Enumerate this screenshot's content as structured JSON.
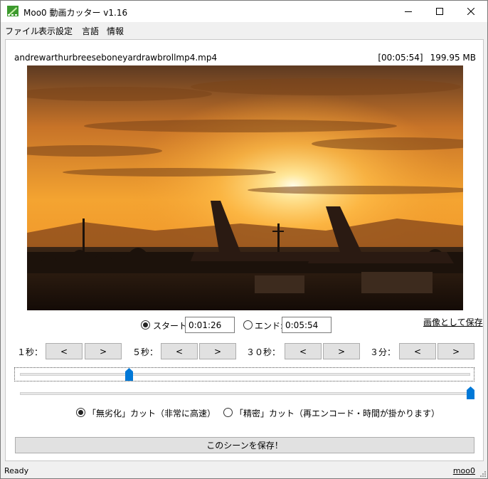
{
  "window": {
    "title": "Moo0 動画カッター v1.16"
  },
  "menu": [
    "ファイル",
    "表示設定",
    "言語",
    "情報"
  ],
  "file": {
    "name": "andrewarthurbreeseboneyardrawbrollmp4.mp4",
    "duration": "[00:05:54]",
    "size": "199.95 MB"
  },
  "video": {
    "description_icon": "video-frame",
    "accent": "#f5a623"
  },
  "range": {
    "start_label": "スタート:",
    "start_value": "0:01:26",
    "end_label": "エンド:",
    "end_value": "0:05:54",
    "save_image_link": "画像として保存",
    "selected": "start"
  },
  "steps": [
    {
      "label": "１秒：",
      "back": "<",
      "forward": ">"
    },
    {
      "label": "５秒：",
      "back": "<",
      "forward": ">"
    },
    {
      "label": "３０秒：",
      "back": "<",
      "forward": ">"
    },
    {
      "label": "３分：",
      "back": "<",
      "forward": ">"
    }
  ],
  "sliders": {
    "start_fraction": 0.243,
    "end_fraction": 1.0,
    "thumb_color": "#0078d7"
  },
  "modes": {
    "lossless": "「無劣化」カット（非常に高速）",
    "precise": "「精密」カット（再エンコード・時間が掛かります）",
    "selected": "lossless"
  },
  "save_scene_button": "このシーンを保存！",
  "status": {
    "text": "Ready",
    "link": "moo0"
  }
}
